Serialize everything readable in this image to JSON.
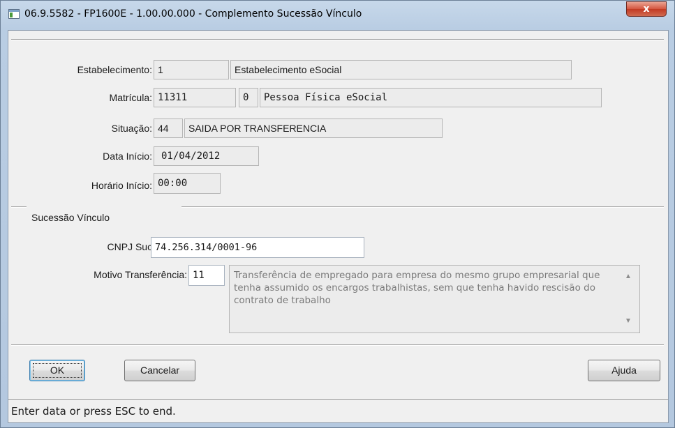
{
  "window": {
    "title": "06.9.5582 - FP1600E - 1.00.00.000 - Complemento Sucessão Vínculo",
    "close_label": "x",
    "icon": "program-window-icon"
  },
  "header": {
    "estabelecimento": {
      "label": "Estabelecimento:",
      "code": "1",
      "name": "Estabelecimento eSocial"
    },
    "matricula": {
      "label": "Matrícula:",
      "value": "11311",
      "digit": "0",
      "name": "Pessoa Física eSocial"
    },
    "situacao": {
      "label": "Situação:",
      "code": "44",
      "description": "SAIDA POR TRANSFERENCIA"
    },
    "data_inicio": {
      "label": "Data Início:",
      "value": "01/04/2012"
    },
    "horario_inicio": {
      "label": "Horário Início:",
      "value": "00:00"
    }
  },
  "sucessao": {
    "group_label": "Sucessão Vínculo",
    "cnpj": {
      "label": "CNPJ Sucessora:",
      "value": "74.256.314/0001-96"
    },
    "motivo": {
      "label": "Motivo Transferência:",
      "code": "11",
      "description": "Transferência de empregado para empresa do mesmo grupo empresarial que tenha assumido os encargos trabalhistas, sem que tenha havido rescisão do contrato de trabalho"
    }
  },
  "buttons": {
    "ok": "OK",
    "cancel": "Cancelar",
    "help": "Ajuda"
  },
  "status_bar": "Enter data or press ESC to end."
}
